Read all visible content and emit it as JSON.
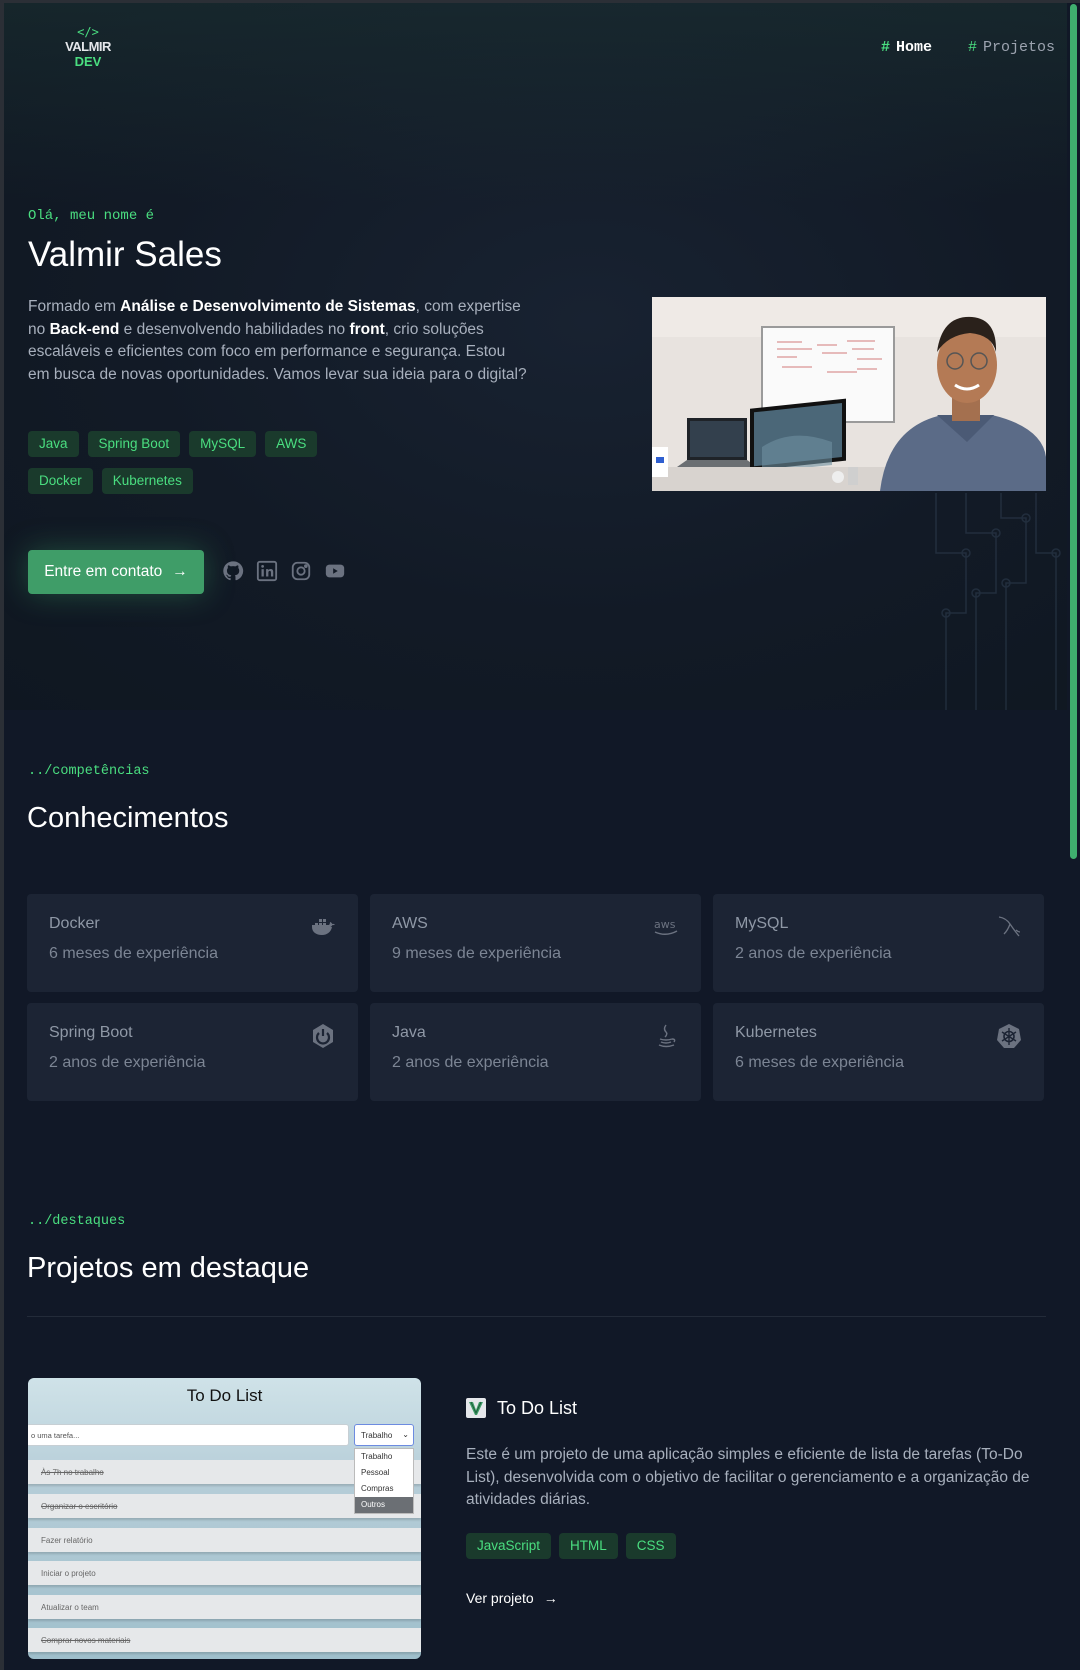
{
  "brand": {
    "code": "</>",
    "line1": "VALMIR",
    "line2": "DEV"
  },
  "nav": [
    {
      "hash": "#",
      "label": "Home"
    },
    {
      "hash": "#",
      "label": "Projetos"
    }
  ],
  "hero": {
    "greeting": "Olá, meu nome é",
    "name": "Valmir Sales",
    "description": {
      "p1": "Formado em ",
      "b1": "Análise e Desenvolvimento de Sistemas",
      "p2": ", com expertise no ",
      "b2": "Back-end",
      "p3": " e desenvolvendo habilidades no ",
      "b3": "front",
      "p4": ", crio soluções escaláveis e eficientes com foco em performance e segurança. Estou em busca de novas oportunidades. Vamos levar sua ideia para o digital?"
    },
    "tags": [
      "Java",
      "Spring Boot",
      "MySQL",
      "AWS",
      "Docker",
      "Kubernetes"
    ],
    "cta_label": "Entre em contato",
    "cta_arrow": "→",
    "socials": [
      "github-icon",
      "linkedin-icon",
      "instagram-icon",
      "youtube-icon"
    ]
  },
  "skills": {
    "kicker": "../competências",
    "title": "Conhecimentos",
    "cards": [
      {
        "name": "Docker",
        "exp": "6 meses de experiência",
        "icon": "docker-icon"
      },
      {
        "name": "AWS",
        "exp": "9 meses de experiência",
        "icon": "aws-icon"
      },
      {
        "name": "MySQL",
        "exp": "2 anos de experiência",
        "icon": "mysql-icon"
      },
      {
        "name": "Spring Boot",
        "exp": "2 anos de experiência",
        "icon": "spring-icon"
      },
      {
        "name": "Java",
        "exp": "2 anos de experiência",
        "icon": "java-icon"
      },
      {
        "name": "Kubernetes",
        "exp": "6 meses de experiência",
        "icon": "kubernetes-icon"
      }
    ]
  },
  "projects": {
    "kicker": "../destaques",
    "title": "Projetos em destaque",
    "items": [
      {
        "name": "To Do List",
        "description": "Este é um projeto de uma aplicação simples e eficiente de lista de tarefas (To-Do List), desenvolvida com o objetivo de facilitar o gerenciamento e a organização de atividades diárias.",
        "tags": [
          "JavaScript",
          "HTML",
          "CSS"
        ],
        "link_label": "Ver projeto",
        "link_arrow": "→",
        "screenshot": {
          "title": "To Do List",
          "input_placeholder": "o uma tarefa...",
          "select_value": "Trabalho",
          "options": [
            "Trabalho",
            "Pessoal",
            "Compras",
            "Outros"
          ],
          "rows": [
            {
              "text": "Às 7h no trabalho",
              "done": true
            },
            {
              "text": "Organizar o escritório",
              "done": true
            },
            {
              "text": "Fazer relatório",
              "done": false
            },
            {
              "text": "Iniciar o projeto",
              "done": false
            },
            {
              "text": "Atualizar o team",
              "done": false
            },
            {
              "text": "Comprar novos materiais",
              "done": true
            }
          ]
        }
      }
    ]
  },
  "colors": {
    "accent": "#4ade80",
    "button": "#3f9d68",
    "bg": "#111827",
    "card": "#1c2434"
  }
}
